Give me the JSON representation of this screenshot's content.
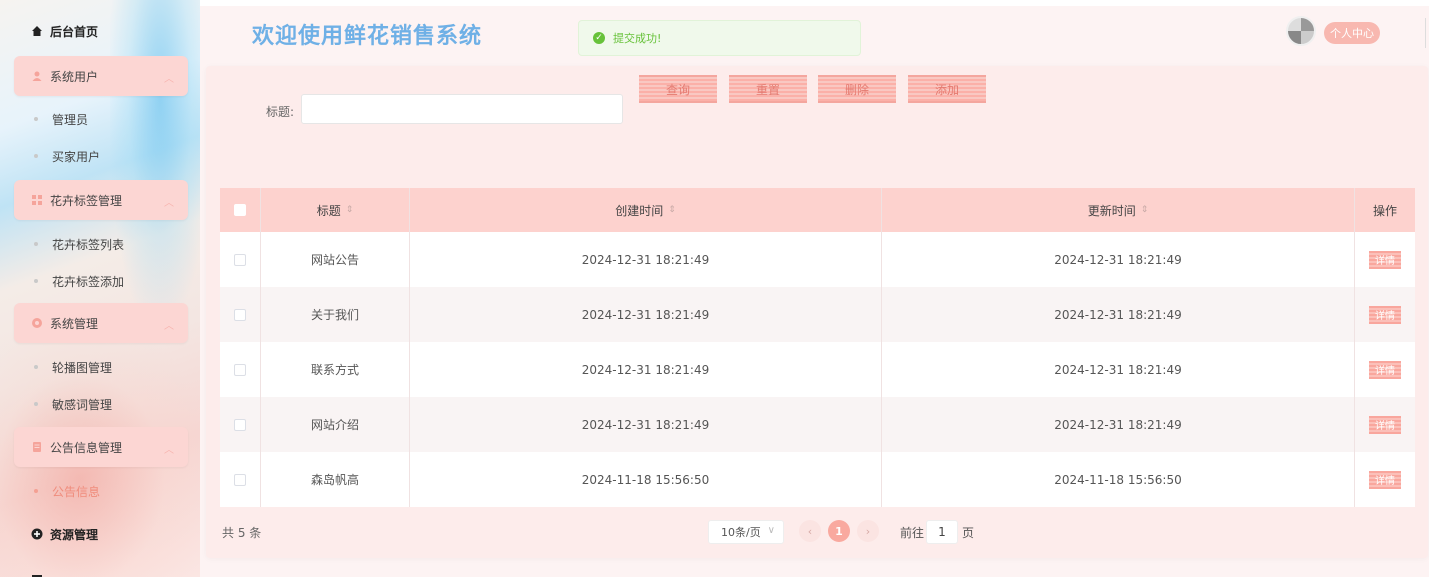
{
  "sidebar": {
    "home": "后台首页",
    "groups": [
      {
        "label": "系统用户",
        "items": [
          "管理员",
          "买家用户"
        ]
      },
      {
        "label": "花卉标签管理",
        "items": [
          "花卉标签列表",
          "花卉标签添加"
        ]
      },
      {
        "label": "系统管理",
        "items": [
          "轮播图管理",
          "敏感词管理"
        ]
      },
      {
        "label": "公告信息管理",
        "items": [
          "公告信息"
        ]
      }
    ],
    "resource": "资源管理",
    "active_item": "公告信息"
  },
  "header": {
    "title": "欢迎使用鲜花销售系统",
    "toast": "提交成功!",
    "profile": "个人中心"
  },
  "search": {
    "label": "标题:",
    "value": ""
  },
  "buttons": {
    "query": "查询",
    "reset": "重置",
    "delete": "删除",
    "add": "添加"
  },
  "table": {
    "headers": [
      "标题",
      "创建时间",
      "更新时间",
      "操作"
    ],
    "rows": [
      {
        "title": "网站公告",
        "created": "2024-12-31 18:21:49",
        "updated": "2024-12-31 18:21:49",
        "action": "详情"
      },
      {
        "title": "关于我们",
        "created": "2024-12-31 18:21:49",
        "updated": "2024-12-31 18:21:49",
        "action": "详情"
      },
      {
        "title": "联系方式",
        "created": "2024-12-31 18:21:49",
        "updated": "2024-12-31 18:21:49",
        "action": "详情"
      },
      {
        "title": "网站介绍",
        "created": "2024-12-31 18:21:49",
        "updated": "2024-12-31 18:21:49",
        "action": "详情"
      },
      {
        "title": "森岛帆高",
        "created": "2024-11-18 15:56:50",
        "updated": "2024-11-18 15:56:50",
        "action": "详情"
      }
    ]
  },
  "pagination": {
    "total": "共 5 条",
    "page_size": "10条/页",
    "current_page": "1",
    "goto_label": "前往",
    "goto_value": "1",
    "page_unit": "页"
  },
  "colors": {
    "accent": "#f9a99f",
    "title": "#6fb0e6",
    "success": "#67c23a"
  }
}
